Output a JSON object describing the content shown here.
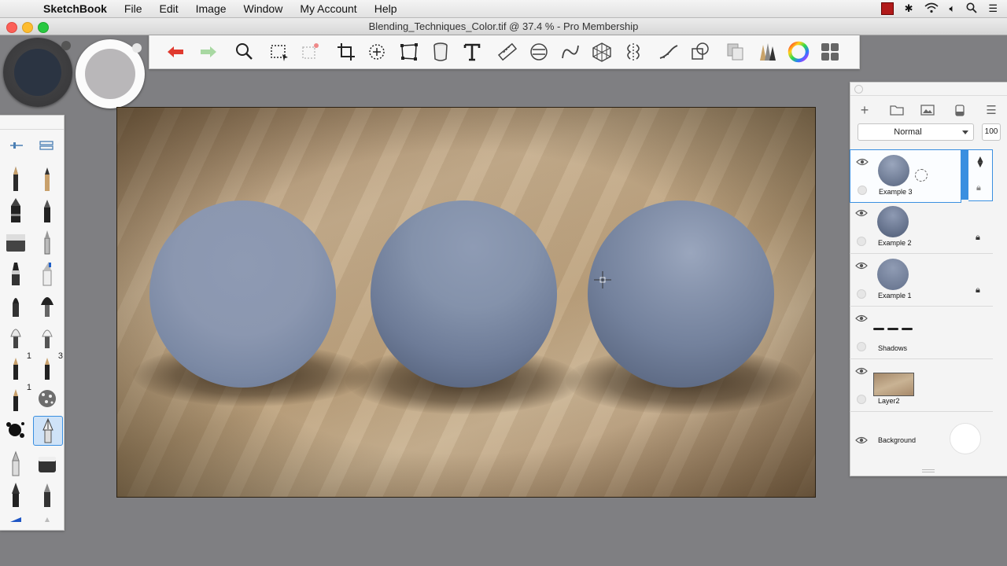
{
  "menubar": {
    "app": "SketchBook",
    "items": [
      "File",
      "Edit",
      "Image",
      "Window",
      "My Account",
      "Help"
    ]
  },
  "window": {
    "title": "Blending_Techniques_Color.tif @ 37.4 % - Pro Membership"
  },
  "colors": {
    "primary": "#2b3442",
    "secondary": "#b9b7b9",
    "canvas_bg": "#bca27f",
    "sphere": "#7f8ea8",
    "selection": "#3a8fe0"
  },
  "toolbar": {
    "tools": [
      "undo-icon",
      "redo-icon",
      "zoom-icon",
      "selection-icon",
      "transform-selection-icon",
      "crop-icon",
      "lasso-icon",
      "distort-icon",
      "fill-icon",
      "text-icon",
      "ruler-icon",
      "ellipse-guide-icon",
      "curve-guide-icon",
      "perspective-icon",
      "symmetry-icon",
      "steady-stroke-icon",
      "shape-icon",
      "copy-paste-icon",
      "brush-palette-icon",
      "color-wheel-icon",
      "layers-icon"
    ]
  },
  "brushes": {
    "badges": [
      "1",
      "3",
      "1"
    ]
  },
  "layers_panel": {
    "blend_mode": "Normal",
    "opacity": "100",
    "layers": [
      {
        "name": "Example 3",
        "selected": true
      },
      {
        "name": "Example 2",
        "selected": false
      },
      {
        "name": "Example 1",
        "selected": false
      },
      {
        "name": "Shadows",
        "selected": false
      },
      {
        "name": "Layer2",
        "selected": false
      },
      {
        "name": "Background",
        "selected": false
      }
    ]
  }
}
